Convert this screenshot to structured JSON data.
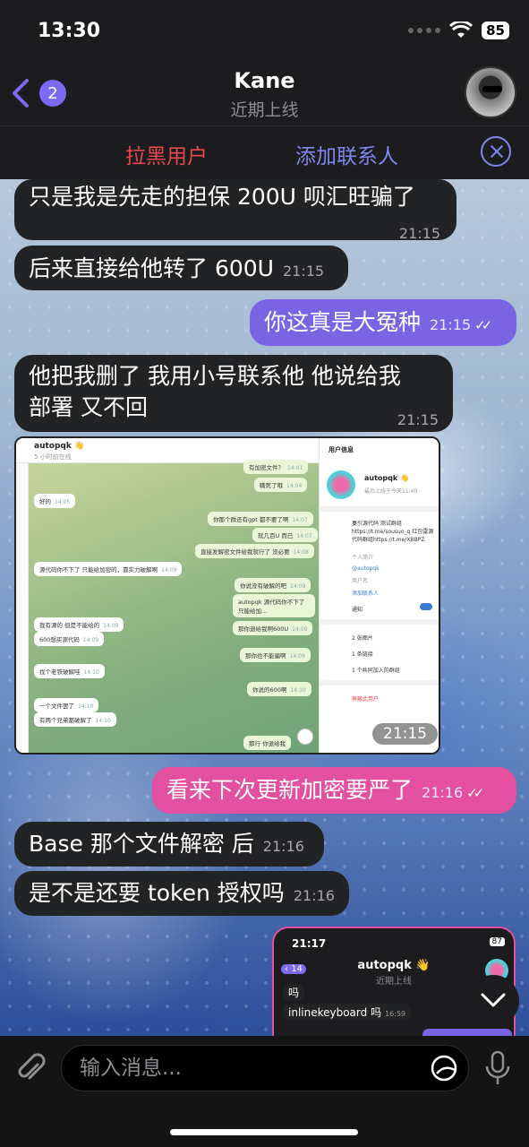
{
  "status": {
    "time": "13:30",
    "battery": "85"
  },
  "header": {
    "back_count": "2",
    "title": "Kane",
    "subtitle": "近期上线"
  },
  "actions": {
    "block_label": "拉黑用户",
    "add_contact_label": "添加联系人"
  },
  "messages": [
    {
      "direction": "in",
      "text": "只是我是先走的担保 200U 呗汇旺骗了",
      "time": "21:15"
    },
    {
      "direction": "in",
      "text": "后来直接给他转了 600U",
      "time": "21:15"
    },
    {
      "direction": "out",
      "text": "你这真是大冤种",
      "time": "21:15",
      "read": true
    },
    {
      "direction": "in",
      "text_line1": "他把我删了  我用小号联系他 他说给我",
      "text_line2": "部署 又不回",
      "time": "21:15"
    },
    {
      "direction": "in",
      "type": "image",
      "time": "21:15"
    },
    {
      "direction": "out",
      "text": "看来下次更新加密要严了",
      "time": "21:16",
      "read": true
    },
    {
      "direction": "in",
      "text": "Base 那个文件解密 后",
      "time": "21:16"
    },
    {
      "direction": "in",
      "text": "是不是还要 token 授权吗",
      "time": "21:16"
    }
  ],
  "screenshot1": {
    "name": "autopqk 👋",
    "seen": "5 小时前在线",
    "chat": [
      {
        "dir": "o",
        "text": "有加密文件？",
        "time": "14:01"
      },
      {
        "dir": "o",
        "text": "瞒死了哦",
        "time": "14:04"
      },
      {
        "dir": "i",
        "text": "好的",
        "time": "14:05"
      },
      {
        "dir": "o",
        "text": "你那个群还有gpt 都不要了啊",
        "time": "14:07"
      },
      {
        "dir": "o",
        "text": "就几百U 而已",
        "time": "14:07"
      },
      {
        "dir": "o",
        "text": "直接发解密文件给我就行了 没必要",
        "time": "14:08"
      },
      {
        "dir": "i",
        "text": "源代码你不下了 只能给加密的，靠实力破解啊",
        "time": "14:09"
      },
      {
        "dir": "o",
        "text": "你说没有破解的吧",
        "time": "14:09"
      },
      {
        "dir": "o",
        "text": "autopqk 源代码你不下了 只能给加...",
        "time": ""
      },
      {
        "dir": "o",
        "text": "那你退给我啊600U",
        "time": "14:09"
      },
      {
        "dir": "i",
        "text": "我有源的 但是不能给的",
        "time": "14:09"
      },
      {
        "dir": "i",
        "text": "600想买源代码",
        "time": "14:09"
      },
      {
        "dir": "o",
        "text": "那你也不能骗啊",
        "time": "14:09"
      },
      {
        "dir": "i",
        "text": "找个老铁破解哇",
        "time": "14:10"
      },
      {
        "dir": "o",
        "text": "你说的600啊",
        "time": "14:10"
      },
      {
        "dir": "i",
        "text": "一个文件罢了",
        "time": "14:10"
      },
      {
        "dir": "i",
        "text": "有两个兄弟都破解了",
        "time": "14:10"
      },
      {
        "dir": "o",
        "text": "那行 你退给我",
        "time": ""
      }
    ],
    "info": {
      "header": "用户信息",
      "name": "autopqk 👋",
      "status": "最后上线于今天11:40",
      "bio": "妻引源代码 测试群组https://t.me/sousuo_q 红包雷源代码群组https://t.me/XBBPZ",
      "bio_label": "个人简介",
      "username": "@autopqk",
      "username_label": "用户名",
      "add_contact": "添加联系人",
      "notify": "通知",
      "photos": "2 张图片",
      "links": "1 条链接",
      "groups": "1 个共同加入的群组",
      "block": "屏蔽此用户"
    },
    "time_badge": "21:15"
  },
  "screenshot2": {
    "time": "21:17",
    "battery": "87",
    "back_count": "14",
    "name": "autopqk 👋",
    "status": "近期上线",
    "msg1": "吗",
    "msg2": "inlinekeyboard 吗",
    "msg2_time": "16:59"
  },
  "input": {
    "placeholder": "输入消息..."
  },
  "colors": {
    "accent": "#7c6bf2",
    "out_purple": "#7a64e3",
    "out_pink": "#e2509f",
    "danger": "#e5484d"
  }
}
